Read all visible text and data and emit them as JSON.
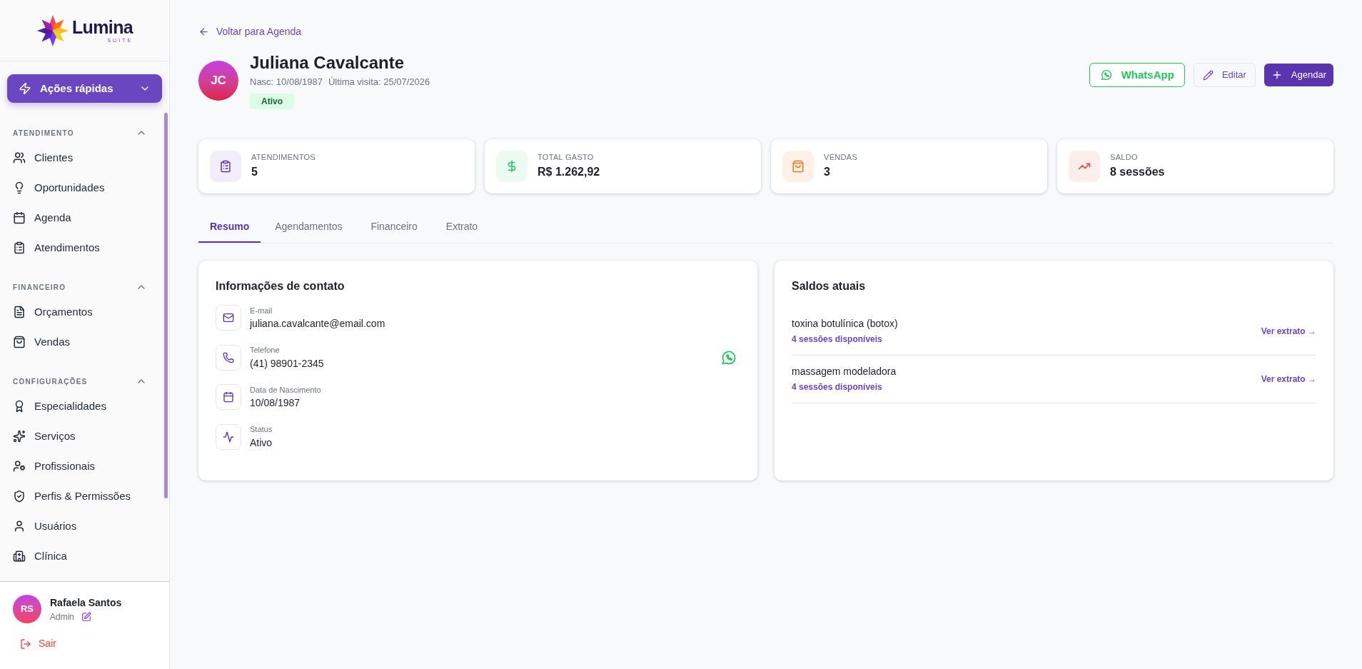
{
  "brand": {
    "name": "Lumina",
    "subtitle": "SUITE"
  },
  "quick_actions": {
    "label": "Ações rápidas",
    "expanded": false
  },
  "sidebar": {
    "sections": [
      {
        "title": "ATENDIMENTO",
        "expanded": true,
        "items": [
          {
            "label": "Clientes"
          },
          {
            "label": "Oportunidades"
          },
          {
            "label": "Agenda"
          },
          {
            "label": "Atendimentos"
          }
        ]
      },
      {
        "title": "FINANCEIRO",
        "expanded": true,
        "items": [
          {
            "label": "Orçamentos"
          },
          {
            "label": "Vendas"
          }
        ]
      },
      {
        "title": "CONFIGURAÇÕES",
        "expanded": true,
        "items": [
          {
            "label": "Especialidades"
          },
          {
            "label": "Serviços"
          },
          {
            "label": "Profissionais"
          },
          {
            "label": "Perfis & Permissões"
          },
          {
            "label": "Usuários"
          },
          {
            "label": "Clínica"
          }
        ]
      }
    ]
  },
  "user": {
    "initials": "RS",
    "name": "Rafaela Santos",
    "role": "Admin",
    "logout": "Sair"
  },
  "back_link": "Voltar para Agenda",
  "client": {
    "initials": "JC",
    "name": "Juliana Cavalcante",
    "birth": "Nasc: 10/08/1987",
    "last_visit": "Última visita: 25/07/2026",
    "status": "Ativo"
  },
  "actions": [
    {
      "kind": "whatsapp",
      "label": "WhatsApp"
    },
    {
      "kind": "edit",
      "label": "Editar"
    },
    {
      "kind": "primary",
      "label": "Agendar"
    }
  ],
  "stats": [
    {
      "color": "#f1edfb",
      "label": "ATENDIMENTOS",
      "value": "5"
    },
    {
      "color": "#ebfbf1",
      "label": "TOTAL GASTO",
      "value": "R$ 1.262,92"
    },
    {
      "color": "#fff1e6",
      "label": "VENDAS",
      "value": "3"
    },
    {
      "color": "#fdeeee",
      "label": "SALDO",
      "value": "8 sessões"
    }
  ],
  "tabs": [
    {
      "label": "Resumo",
      "selected": true
    },
    {
      "label": "Agendamentos",
      "selected": false
    },
    {
      "label": "Financeiro",
      "selected": false
    },
    {
      "label": "Extrato",
      "selected": false
    }
  ],
  "contact": {
    "title": "Informações de contato",
    "fields": [
      {
        "label": "E-mail",
        "value": "juliana.cavalcante@email.com",
        "whatsapp": false
      },
      {
        "label": "Telefone",
        "value": "(41) 98901-2345",
        "whatsapp": true
      },
      {
        "label": "Data de Nascimento",
        "value": "10/08/1987",
        "whatsapp": false
      },
      {
        "label": "Status",
        "value": "Ativo",
        "whatsapp": false
      }
    ]
  },
  "balances": {
    "title": "Saldos atuais",
    "items": [
      {
        "name": "toxina botulínica (botox)",
        "sessions": "4 sessões disponíveis",
        "link": "Ver extrato →"
      },
      {
        "name": "massagem modeladora",
        "sessions": "4 sessões disponíveis",
        "link": "Ver extrato →"
      }
    ]
  }
}
